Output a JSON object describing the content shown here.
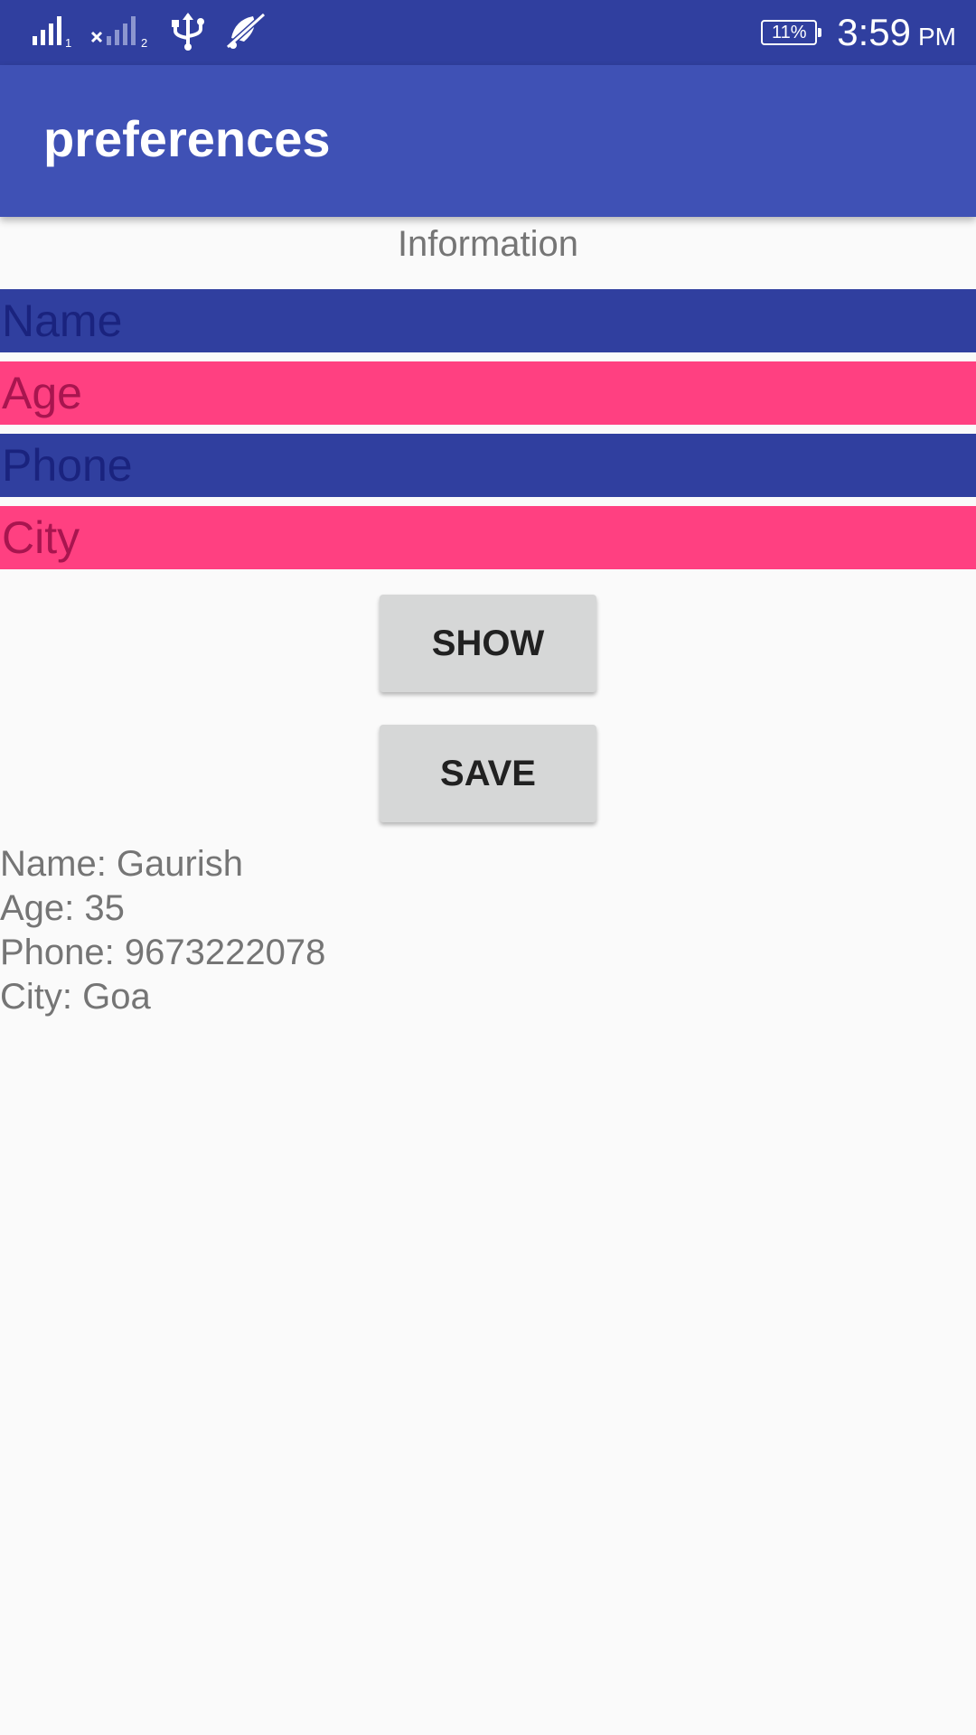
{
  "status_bar": {
    "icons": [
      "signal-sim1-icon",
      "signal-sim2-no-service-icon",
      "usb-icon",
      "notifications-off-icon"
    ],
    "battery_level": "11%",
    "time": "3:59",
    "ampm": "PM"
  },
  "app_bar": {
    "title": "preferences",
    "color": "#3f51b5"
  },
  "form": {
    "header": "Information",
    "fields": [
      {
        "placeholder": "Name",
        "value": "",
        "color": "#303f9f"
      },
      {
        "placeholder": "Age",
        "value": "",
        "color": "#ff4081"
      },
      {
        "placeholder": "Phone",
        "value": "",
        "color": "#303f9f"
      },
      {
        "placeholder": "City",
        "value": "",
        "color": "#ff4081"
      }
    ]
  },
  "buttons": {
    "show_label": "SHOW",
    "save_label": "SAVE"
  },
  "output": {
    "lines": [
      "Name: Gaurish",
      "Age: 35",
      "Phone: 9673222078",
      "City: Goa"
    ]
  }
}
